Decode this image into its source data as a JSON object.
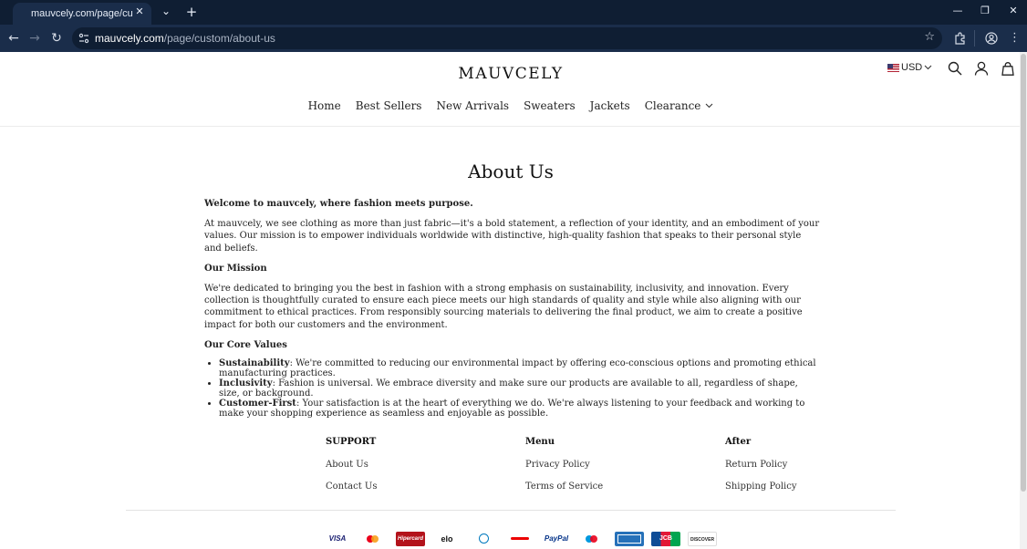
{
  "browser": {
    "tab_title": "mauvcely.com/page/custom/about-us",
    "tab_close": "✕",
    "tab_list": "⌄",
    "new_tab": "+",
    "minimize": "—",
    "restore": "❐",
    "close": "✕",
    "url_host": "mauvcely.com",
    "url_path": "/page/custom/about-us"
  },
  "header": {
    "brand": "MAUVCELY",
    "currency": "USD",
    "nav": [
      "Home",
      "Best Sellers",
      "New Arrivals",
      "Sweaters",
      "Jackets",
      "Clearance"
    ]
  },
  "main": {
    "title": "About Us",
    "intro_bold": "Welcome to mauvcely, where fashion meets purpose.",
    "intro": "At mauvcely, we see clothing as more than just fabric—it's a bold statement, a reflection of your identity, and an embodiment of your values. Our mission is to empower individuals worldwide with distinctive, high-quality fashion that speaks to their personal style and beliefs.",
    "mission_heading": "Our Mission",
    "mission": "We're dedicated to bringing you the best in fashion with a strong emphasis on sustainability, inclusivity, and innovation. Every collection is thoughtfully curated to ensure each piece meets our high standards of quality and style while also aligning with our commitment to ethical practices. From responsibly sourcing materials to delivering the final product, we aim to create a positive impact for both our customers and the environment.",
    "values_heading": "Our Core Values",
    "values": [
      {
        "label": "Sustainability",
        "text": ": We're committed to reducing our environmental impact by offering eco-conscious options and promoting ethical manufacturing practices."
      },
      {
        "label": "Inclusivity",
        "text": ": Fashion is universal. We embrace diversity and make sure our products are available to all, regardless of shape, size, or background."
      },
      {
        "label": "Customer-First",
        "text": ": Your satisfaction is at the heart of everything we do. We're always listening to your feedback and working to make your shopping experience as seamless and enjoyable as possible."
      }
    ]
  },
  "footer": {
    "columns": [
      {
        "heading": "SUPPORT",
        "links": [
          "About Us",
          "Contact Us"
        ]
      },
      {
        "heading": "Menu",
        "links": [
          "Privacy Policy",
          "Terms of Service"
        ]
      },
      {
        "heading": "After",
        "links": [
          "Return Policy",
          "Shipping Policy"
        ]
      }
    ],
    "payments": [
      "VISA",
      "Mastercard",
      "Hipercard",
      "elo",
      "Diners Club",
      "Santander",
      "PayPal",
      "Maestro",
      "American Express",
      "JCB",
      "DISCOVER"
    ],
    "payment_labels": [
      "VISA",
      "",
      "Hipercard",
      "elo",
      "",
      "",
      "PayPal",
      "",
      "",
      "JCB",
      "DISCOVER"
    ]
  }
}
